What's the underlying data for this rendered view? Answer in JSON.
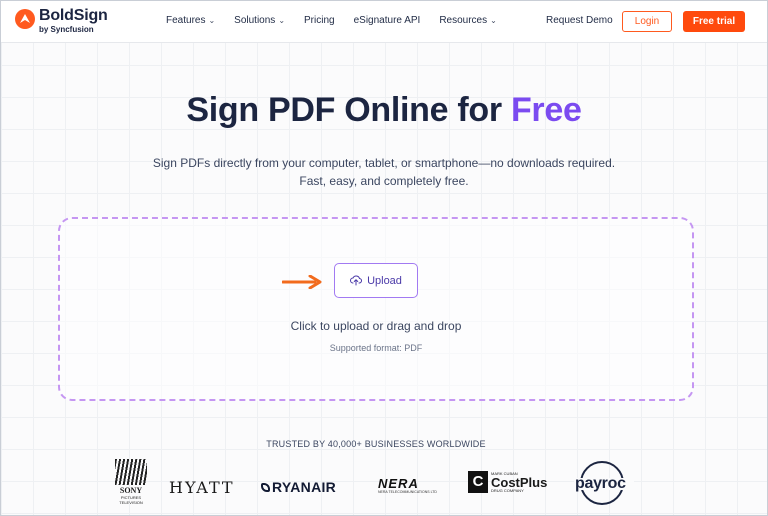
{
  "brand": {
    "name": "BoldSign",
    "sub": "by Syncfusion",
    "accent_color": "#ff5a1f",
    "purple_accent": "#7b4bf0"
  },
  "nav": {
    "items": [
      {
        "label": "Features",
        "has_dropdown": true
      },
      {
        "label": "Solutions",
        "has_dropdown": true
      },
      {
        "label": "Pricing",
        "has_dropdown": false
      },
      {
        "label": "eSignature API",
        "has_dropdown": false
      },
      {
        "label": "Resources",
        "has_dropdown": true
      }
    ],
    "chevron": "⌄",
    "request_demo": "Request Demo",
    "login": "Login",
    "free_trial": "Free trial"
  },
  "hero": {
    "title_main": "Sign PDF Online for ",
    "title_accent": "Free",
    "subtitle_line1": "Sign PDFs directly from your computer, tablet, or smartphone—no downloads required.",
    "subtitle_line2": "Fast, easy, and completely free."
  },
  "upload": {
    "button_label": "Upload",
    "icon": "cloud-upload-icon",
    "drop_text": "Click to upload or drag and drop",
    "format_text": "Supported format: PDF"
  },
  "trusted": {
    "heading": "TRUSTED BY 40,000+ BUSINESSES WORLDWIDE",
    "logos": {
      "sony_line1": "SONY",
      "sony_line2": "PICTURES",
      "sony_line3": "TELEVISION",
      "hyatt": "HYATT",
      "ryanair": "RYANAIR",
      "nera": "NERA",
      "nera_sub": "NERA TELECOMMUNICATIONS LTD",
      "costplus_small": "MARK CUBAN",
      "costplus_main": "CostPlus",
      "costplus_sub": "DRUG COMPANY",
      "payroc": "payroc"
    }
  }
}
